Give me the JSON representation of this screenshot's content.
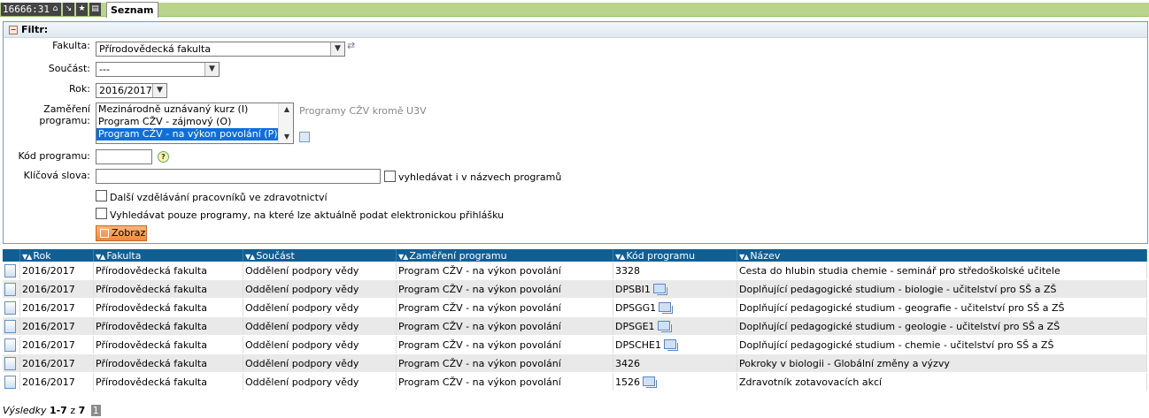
{
  "topbar": {
    "counter": "16666:31",
    "tab_label": "Seznam"
  },
  "filter": {
    "header": "Filtr:",
    "fakulta_label": "Fakulta:",
    "fakulta_value": "Přírodovědecká fakulta",
    "soucast_label": "Součást:",
    "soucast_value": "---",
    "rok_label": "Rok:",
    "rok_value": "2016/2017",
    "zamereni_label": "Zaměření programu:",
    "zamereni_options": [
      "Mezinárodně uznávaný kurz (I)",
      "Program CŽV - zájmový (O)",
      "Program CŽV - na výkon povolání (P)"
    ],
    "zamereni_note": "Programy CŽV kromě U3V",
    "kod_label": "Kód programu:",
    "kod_value": "",
    "klicova_label": "Klíčová slova:",
    "klicova_value": "",
    "hledat_nazvy_label": "vyhledávat i v názvech programů",
    "zdravotnictvi_label": "Další vzdělávání pracovníků ve zdravotnictví",
    "prihlaska_label": "Vyhledávat pouze programy, na které lze aktuálně podat elektronickou přihlášku",
    "submit_label": "Zobraz"
  },
  "table": {
    "columns": [
      "Rok",
      "Fakulta",
      "Součást",
      "Zaměření programu",
      "Kód programu",
      "Název"
    ],
    "rows": [
      {
        "rok": "2016/2017",
        "fakulta": "Přírodovědecká fakulta",
        "soucast": "Oddělení podpory vědy",
        "zamereni": "Program CŽV - na výkon povolání",
        "kod": "3328",
        "nazev": "Cesta do hlubin studia chemie - seminář pro středoškolské učitele",
        "stack": false
      },
      {
        "rok": "2016/2017",
        "fakulta": "Přírodovědecká fakulta",
        "soucast": "Oddělení podpory vědy",
        "zamereni": "Program CŽV - na výkon povolání",
        "kod": "DPSBI1",
        "nazev": "Doplňující pedagogické studium - biologie - učitelství pro SŠ a ZŠ",
        "stack": true
      },
      {
        "rok": "2016/2017",
        "fakulta": "Přírodovědecká fakulta",
        "soucast": "Oddělení podpory vědy",
        "zamereni": "Program CŽV - na výkon povolání",
        "kod": "DPSGG1",
        "nazev": "Doplňující pedagogické studium - geografie - učitelství pro SŠ a ZŠ",
        "stack": true
      },
      {
        "rok": "2016/2017",
        "fakulta": "Přírodovědecká fakulta",
        "soucast": "Oddělení podpory vědy",
        "zamereni": "Program CŽV - na výkon povolání",
        "kod": "DPSGE1",
        "nazev": "Doplňující pedagogické studium - geologie - učitelství pro SŠ a ZŠ",
        "stack": true
      },
      {
        "rok": "2016/2017",
        "fakulta": "Přírodovědecká fakulta",
        "soucast": "Oddělení podpory vědy",
        "zamereni": "Program CŽV - na výkon povolání",
        "kod": "DPSCHE1",
        "nazev": "Doplňující pedagogické studium - chemie - učitelství pro SŠ a ZŠ",
        "stack": true
      },
      {
        "rok": "2016/2017",
        "fakulta": "Přírodovědecká fakulta",
        "soucast": "Oddělení podpory vědy",
        "zamereni": "Program CŽV - na výkon povolání",
        "kod": "3426",
        "nazev": "Pokroky v biologii - Globální změny a výzvy",
        "stack": false
      },
      {
        "rok": "2016/2017",
        "fakulta": "Přírodovědecká fakulta",
        "soucast": "Oddělení podpory vědy",
        "zamereni": "Program CŽV - na výkon povolání",
        "kod": "1526",
        "nazev": "Zdravotník zotavovacích akcí",
        "stack": true
      }
    ]
  },
  "footer": {
    "label": "Výsledky",
    "range": "1-7",
    "of": "z",
    "total": "7",
    "page": "1"
  }
}
